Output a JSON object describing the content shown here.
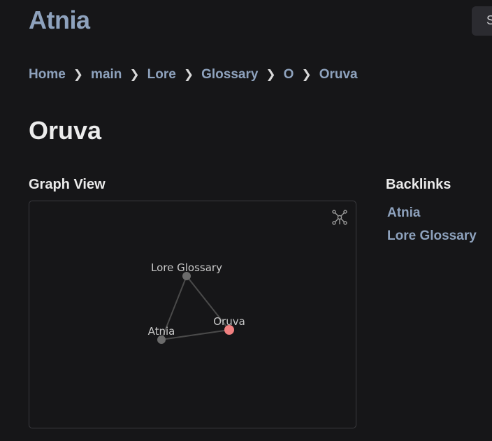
{
  "header": {
    "site_title": "Atnia",
    "search_label": "S"
  },
  "breadcrumb": [
    {
      "label": "Home"
    },
    {
      "label": "main"
    },
    {
      "label": "Lore"
    },
    {
      "label": "Glossary"
    },
    {
      "label": "O"
    },
    {
      "label": "Oruva"
    }
  ],
  "breadcrumb_separator": "❯",
  "page": {
    "title": "Oruva"
  },
  "graph_view": {
    "heading": "Graph View",
    "toolbar_icon": "global-graph-icon",
    "nodes": [
      {
        "id": "lore-glossary",
        "label": "Lore Glossary",
        "color": "#6b6b6b"
      },
      {
        "id": "atnia",
        "label": "Atnia",
        "color": "#6b6b6b"
      },
      {
        "id": "oruva",
        "label": "Oruva",
        "color": "#f08080",
        "current": true
      }
    ],
    "edges": [
      [
        "lore-glossary",
        "atnia"
      ],
      [
        "lore-glossary",
        "oruva"
      ],
      [
        "atnia",
        "oruva"
      ]
    ],
    "edge_color": "#4a4a4a"
  },
  "backlinks": {
    "heading": "Backlinks",
    "items": [
      {
        "label": "Atnia"
      },
      {
        "label": "Lore Glossary"
      }
    ]
  },
  "colors": {
    "background": "#161618",
    "link": "#8ea2bd",
    "heading": "#ececec"
  }
}
